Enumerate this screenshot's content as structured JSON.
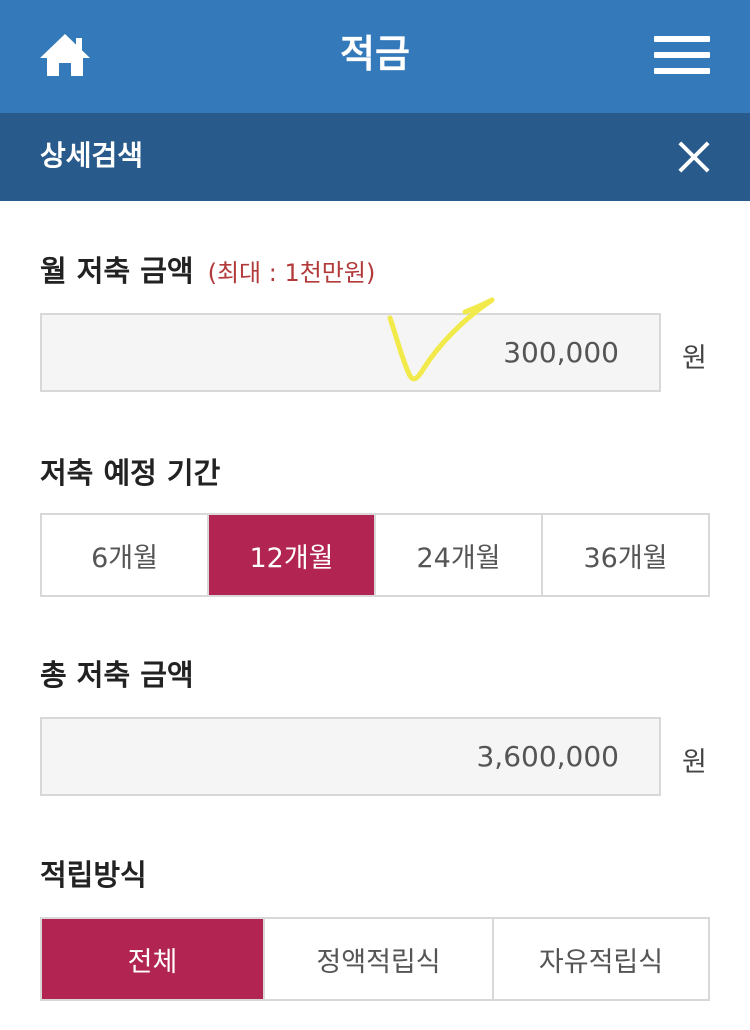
{
  "header": {
    "title": "적금",
    "home_icon": "home-icon",
    "menu_icon": "hamburger-menu-icon"
  },
  "sub_header": {
    "title": "상세검색",
    "close_icon": "close-icon"
  },
  "monthly_amount": {
    "label": "월 저축 금액",
    "hint": "(최대 : 1천만원)",
    "value": "300,000",
    "unit": "원"
  },
  "period": {
    "label": "저축 예정 기간",
    "options": [
      "6개월",
      "12개월",
      "24개월",
      "36개월"
    ],
    "selected": "12개월"
  },
  "total_amount": {
    "label": "총 저축 금액",
    "value": "3,600,000",
    "unit": "원"
  },
  "method": {
    "label": "적립방식",
    "options": [
      "전체",
      "정액적립식",
      "자유적립식"
    ],
    "selected": "전체"
  },
  "colors": {
    "header_bg": "#3479b9",
    "subheader_bg": "#285b8b",
    "active": "#b22552",
    "hint": "#b23a3a",
    "annotation": "#f2ea4a"
  }
}
